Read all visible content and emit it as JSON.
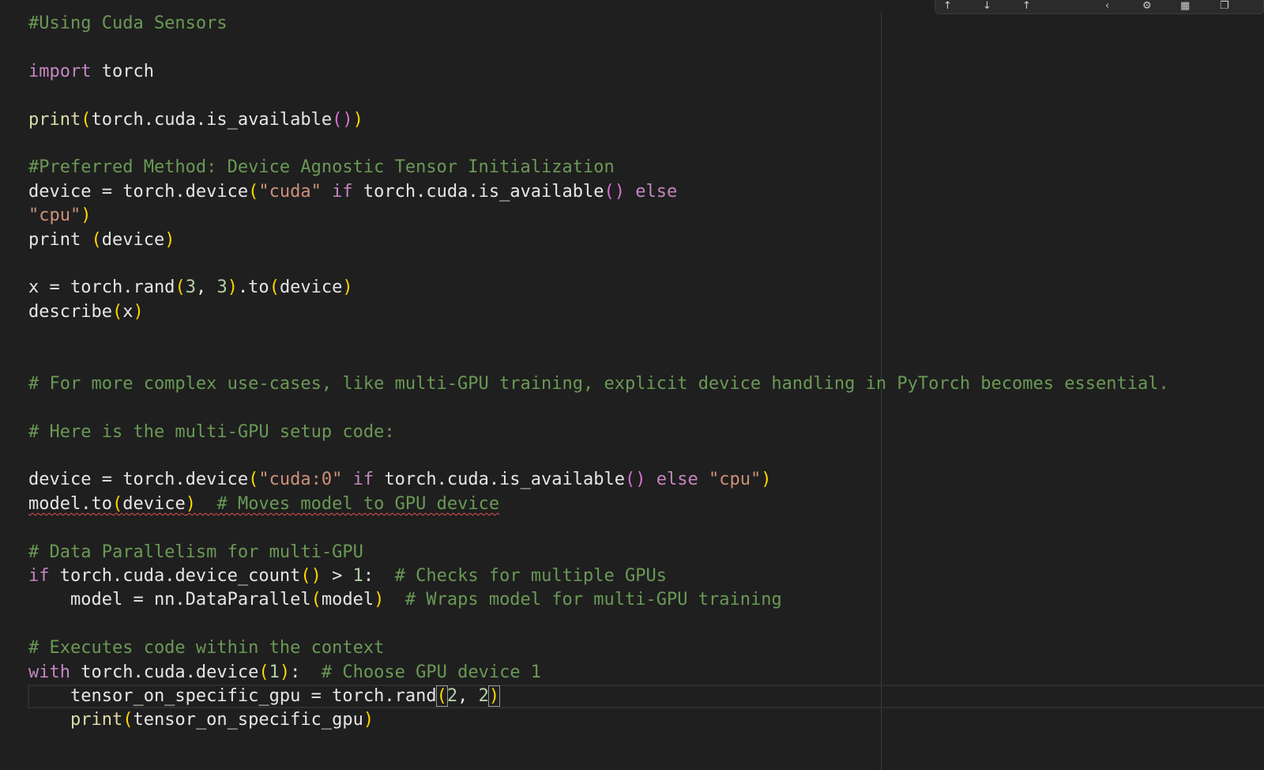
{
  "editor": {
    "toolbar": {
      "icons": [
        "step-over-icon",
        "step-into-icon",
        "step-out-icon",
        "search-icon",
        "gear-icon",
        "chart-icon",
        "window-icon"
      ],
      "glyphs": [
        "↑",
        "↓",
        "↑",
        "‹",
        "⚙",
        "▦",
        "❐"
      ]
    },
    "colors": {
      "background": "#1f1f1f",
      "comment": "#6a9955",
      "keyword": "#c586c0",
      "function": "#dcdcaa",
      "string": "#ce9178",
      "number": "#b5cea8",
      "bracket": "#ffd700",
      "error": "#e05252"
    },
    "lines": [
      [
        [
          "c",
          "#Using Cuda Sensors"
        ]
      ],
      [],
      [
        [
          "k",
          "import"
        ],
        [
          "p",
          " torch"
        ]
      ],
      [],
      [
        [
          "f",
          "print"
        ],
        [
          "b1",
          "("
        ],
        [
          "p",
          "torch.cuda.is_available"
        ],
        [
          "b2",
          "()"
        ],
        [
          "b1",
          ")"
        ]
      ],
      [],
      [
        [
          "c",
          "#Preferred Method: Device Agnostic Tensor Initialization"
        ]
      ],
      [
        [
          "p",
          "device = torch.device"
        ],
        [
          "b1",
          "("
        ],
        [
          "s",
          "\"cuda\""
        ],
        [
          "p",
          " "
        ],
        [
          "k",
          "if"
        ],
        [
          "p",
          " torch.cuda.is_available"
        ],
        [
          "b2",
          "()"
        ],
        [
          "p",
          " "
        ],
        [
          "k",
          "else"
        ]
      ],
      [
        [
          "s",
          "\"cpu\""
        ],
        [
          "b1",
          ")"
        ]
      ],
      [
        [
          "p",
          "print "
        ],
        [
          "b1",
          "("
        ],
        [
          "p",
          "device"
        ],
        [
          "b1",
          ")"
        ]
      ],
      [],
      [
        [
          "p",
          "x = torch.rand"
        ],
        [
          "b1",
          "("
        ],
        [
          "n",
          "3"
        ],
        [
          "p",
          ", "
        ],
        [
          "n",
          "3"
        ],
        [
          "b1",
          ")"
        ],
        [
          "p",
          ".to"
        ],
        [
          "b1",
          "("
        ],
        [
          "p",
          "device"
        ],
        [
          "b1",
          ")"
        ]
      ],
      [
        [
          "p",
          "describe"
        ],
        [
          "b1",
          "("
        ],
        [
          "p",
          "x"
        ],
        [
          "b1",
          ")"
        ]
      ],
      [],
      [],
      [
        [
          "c",
          "# For more complex use-cases, like multi-GPU training, explicit device handling in PyTorch becomes essential."
        ]
      ],
      [],
      [
        [
          "c",
          "# Here is the multi-GPU setup code:"
        ]
      ],
      [],
      [
        [
          "p",
          "device = torch.device"
        ],
        [
          "b1",
          "("
        ],
        [
          "s",
          "\"cuda:0\""
        ],
        [
          "p",
          " "
        ],
        [
          "k",
          "if"
        ],
        [
          "p",
          " torch.cuda.is_available"
        ],
        [
          "b2",
          "()"
        ],
        [
          "p",
          " "
        ],
        [
          "k",
          "else"
        ],
        [
          "p",
          " "
        ],
        [
          "s",
          "\"cpu\""
        ],
        [
          "b1",
          ")"
        ]
      ],
      [
        [
          "pw",
          "model.to"
        ],
        [
          "b1w",
          "("
        ],
        [
          "pw",
          "device"
        ],
        [
          "b1w",
          ")"
        ],
        [
          "pw",
          "  "
        ],
        [
          "cw",
          "# Moves model to GPU device"
        ]
      ],
      [],
      [
        [
          "c",
          "# Data Parallelism for multi-GPU"
        ]
      ],
      [
        [
          "k",
          "if"
        ],
        [
          "p",
          " torch.cuda.device_count"
        ],
        [
          "b1",
          "()"
        ],
        [
          "p",
          " > "
        ],
        [
          "n",
          "1"
        ],
        [
          "p",
          ":  "
        ],
        [
          "c",
          "# Checks for multiple GPUs"
        ]
      ],
      [
        [
          "p",
          "    model = nn.DataParallel"
        ],
        [
          "b1",
          "("
        ],
        [
          "p",
          "model"
        ],
        [
          "b1",
          ")"
        ],
        [
          "p",
          "  "
        ],
        [
          "c",
          "# Wraps model for multi-GPU training"
        ]
      ],
      [],
      [
        [
          "c",
          "# Executes code within the context"
        ]
      ],
      [
        [
          "k",
          "with"
        ],
        [
          "p",
          " torch.cuda.device"
        ],
        [
          "b1",
          "("
        ],
        [
          "n",
          "1"
        ],
        [
          "b1",
          ")"
        ],
        [
          "p",
          ":  "
        ],
        [
          "c",
          "# Choose GPU device 1"
        ]
      ],
      [
        [
          "p",
          "    tensor_on_specific_gpu = torch.rand"
        ],
        [
          "bm",
          "("
        ],
        [
          "n",
          "2"
        ],
        [
          "p",
          ", "
        ],
        [
          "n",
          "2"
        ],
        [
          "bm",
          ")"
        ]
      ],
      [
        [
          "p",
          "    "
        ],
        [
          "f",
          "print"
        ],
        [
          "b1",
          "("
        ],
        [
          "p",
          "tensor_on_specific_gpu"
        ],
        [
          "b1",
          ")"
        ]
      ]
    ],
    "current_line": 28
  }
}
